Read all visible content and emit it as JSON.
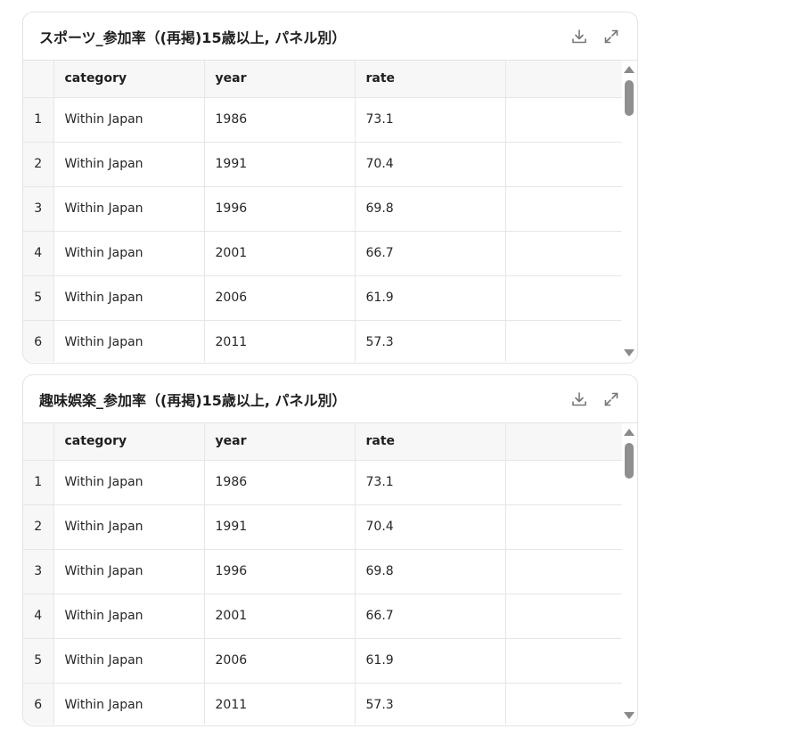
{
  "panels": [
    {
      "title": "スポーツ_参加率（(再掲)15歳以上, パネル別）",
      "download_icon": "download-icon",
      "expand_icon": "expand-icon",
      "columns": [
        "",
        "category",
        "year",
        "rate",
        ""
      ],
      "rows": [
        [
          "1",
          "Within Japan",
          "1986",
          "73.1"
        ],
        [
          "2",
          "Within Japan",
          "1991",
          "70.4"
        ],
        [
          "3",
          "Within Japan",
          "1996",
          "69.8"
        ],
        [
          "4",
          "Within Japan",
          "2001",
          "66.7"
        ],
        [
          "5",
          "Within Japan",
          "2006",
          "61.9"
        ],
        [
          "6",
          "Within Japan",
          "2011",
          "57.3"
        ]
      ]
    },
    {
      "title": "趣味娯楽_参加率（(再掲)15歳以上, パネル別）",
      "download_icon": "download-icon",
      "expand_icon": "expand-icon",
      "columns": [
        "",
        "category",
        "year",
        "rate",
        ""
      ],
      "rows": [
        [
          "1",
          "Within Japan",
          "1986",
          "73.1"
        ],
        [
          "2",
          "Within Japan",
          "1991",
          "70.4"
        ],
        [
          "3",
          "Within Japan",
          "1996",
          "69.8"
        ],
        [
          "4",
          "Within Japan",
          "2001",
          "66.7"
        ],
        [
          "5",
          "Within Japan",
          "2006",
          "61.9"
        ],
        [
          "6",
          "Within Japan",
          "2011",
          "57.3"
        ]
      ]
    }
  ]
}
